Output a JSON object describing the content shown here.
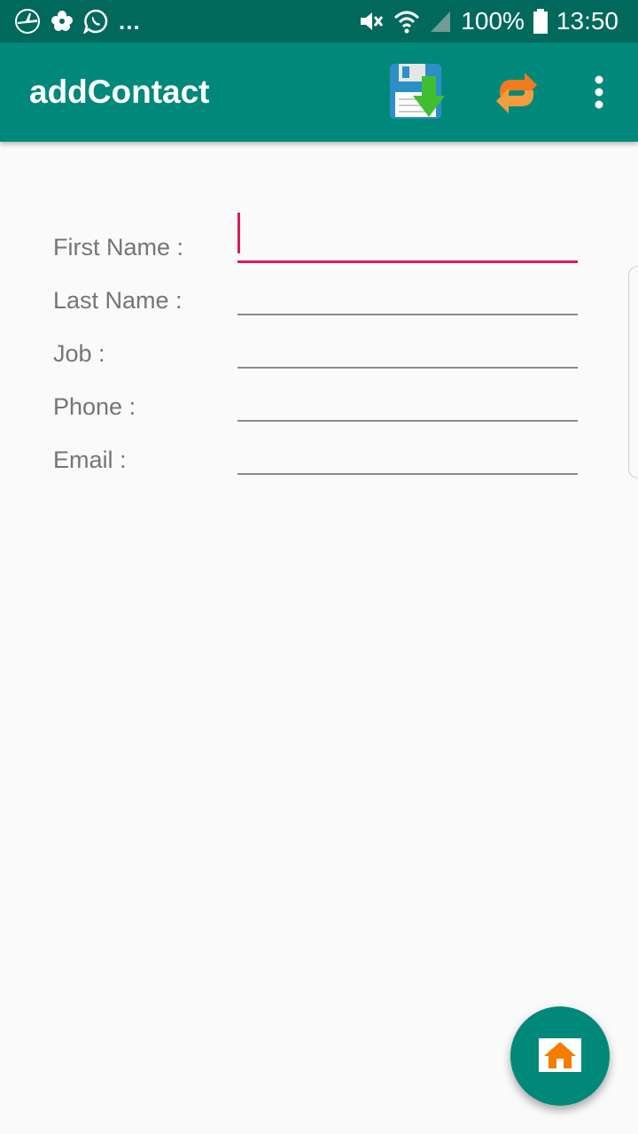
{
  "status_bar": {
    "overflow": "...",
    "battery": "100%",
    "time": "13:50",
    "icons": [
      "plane-app-icon",
      "flower-app-icon",
      "whatsapp-icon",
      "mute-icon",
      "wifi-icon",
      "signal-icon",
      "battery-icon"
    ]
  },
  "app_bar": {
    "title": "addContact",
    "actions": [
      "save-icon",
      "sync-icon",
      "more-vert-icon"
    ],
    "background": "#00897b",
    "status_background": "#00695c"
  },
  "form": {
    "fields": [
      {
        "label": "First Name :",
        "value": "",
        "focused": true
      },
      {
        "label": "Last Name :",
        "value": ""
      },
      {
        "label": "Job :",
        "value": ""
      },
      {
        "label": "Phone :",
        "value": ""
      },
      {
        "label": "Email :",
        "value": ""
      }
    ],
    "accent": "#d81b60"
  },
  "fab": {
    "icon": "home-icon",
    "color": "#00897b"
  }
}
